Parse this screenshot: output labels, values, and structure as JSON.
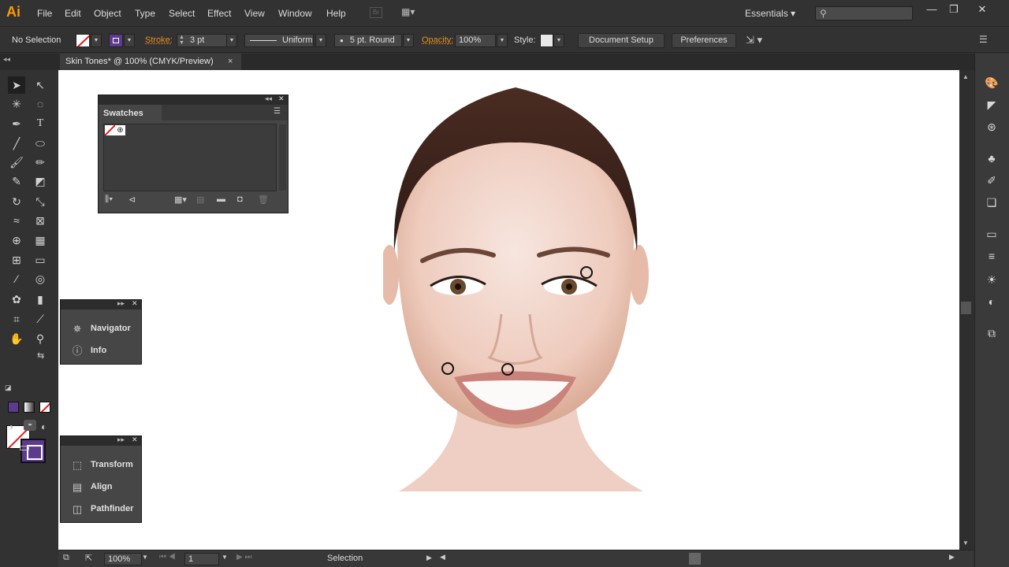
{
  "app": {
    "logo": "Ai"
  },
  "menus": [
    "File",
    "Edit",
    "Object",
    "Type",
    "Select",
    "Effect",
    "View",
    "Window",
    "Help"
  ],
  "bridge_label": "Br",
  "workspace": "Essentials",
  "window_controls": {
    "minimize": "—",
    "maximize": "❐",
    "close": "✕"
  },
  "control_bar": {
    "selection_text": "No Selection",
    "stroke_label": "Stroke:",
    "stroke_value": "3 pt",
    "stroke_profile": "Uniform",
    "brush_label": "5 pt. Round",
    "opacity_label": "Opacity:",
    "opacity_value": "100%",
    "style_label": "Style:",
    "document_setup": "Document Setup",
    "preferences": "Preferences"
  },
  "document_tab": {
    "title": "Skin Tones* @ 100% (CMYK/Preview)",
    "close": "×"
  },
  "swatches_panel": {
    "title": "Swatches"
  },
  "panel_group_1": {
    "items": [
      {
        "label": "Navigator",
        "icon": "navigator-icon"
      },
      {
        "label": "Info",
        "icon": "info-icon"
      }
    ]
  },
  "panel_group_2": {
    "items": [
      {
        "label": "Transform",
        "icon": "transform-icon"
      },
      {
        "label": "Align",
        "icon": "align-icon"
      },
      {
        "label": "Pathfinder",
        "icon": "pathfinder-icon"
      }
    ]
  },
  "status_bar": {
    "zoom": "100%",
    "artboard": "1",
    "tool": "Selection"
  },
  "colors": {
    "accent_orange": "#e8901c",
    "stroke_purple": "#5c3a8c",
    "none_red": "#e01c1c"
  }
}
